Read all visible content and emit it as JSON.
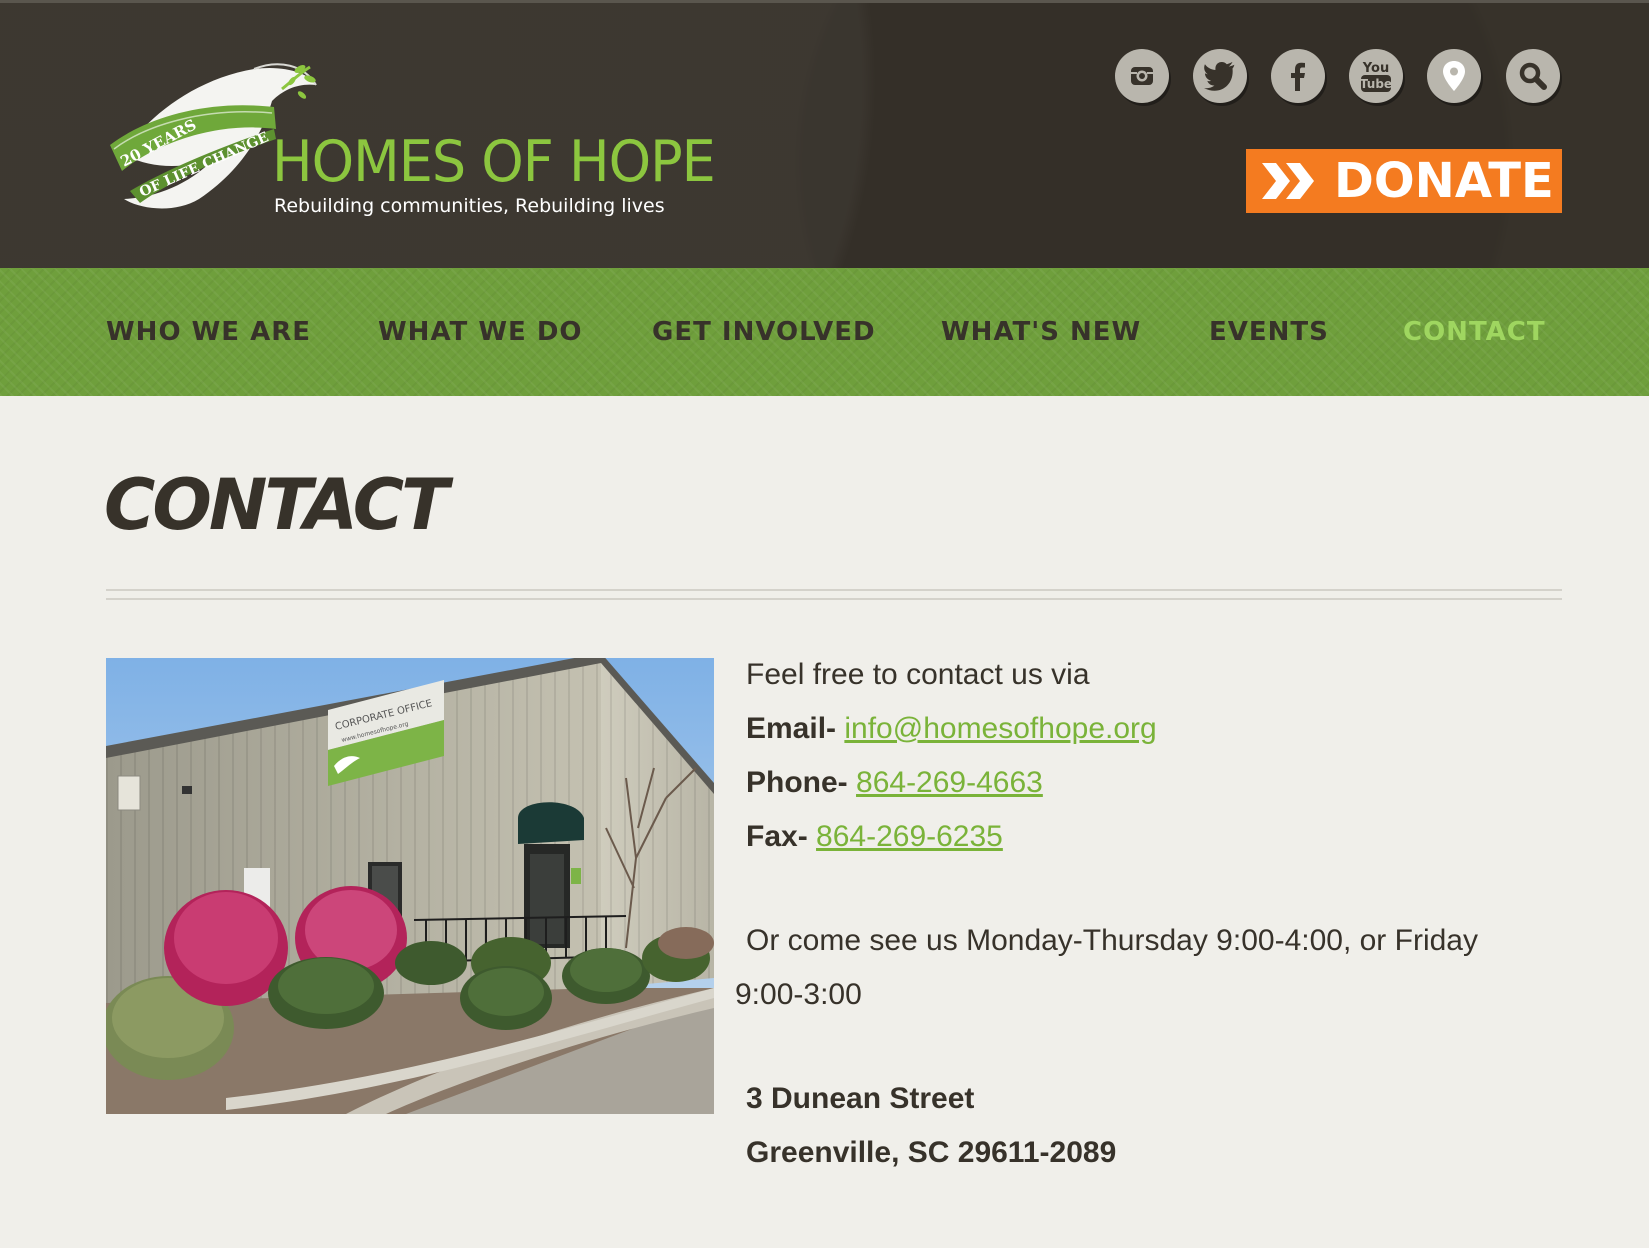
{
  "header": {
    "logo": {
      "ribbon_text": "20 YEARS OF LIFE CHANGE",
      "title": "HOMES OF HOPE",
      "tagline": "Rebuilding communities, Rebuilding lives"
    },
    "social_icons": [
      "instagram-icon",
      "twitter-icon",
      "facebook-icon",
      "youtube-icon",
      "map-pin-icon",
      "search-icon"
    ],
    "youtube_text_top": "You",
    "youtube_text_bottom": "Tube",
    "donate_label": "DONATE"
  },
  "nav": {
    "items": [
      {
        "label": "WHO WE ARE"
      },
      {
        "label": "WHAT WE DO"
      },
      {
        "label": "GET INVOLVED"
      },
      {
        "label": "WHAT'S NEW"
      },
      {
        "label": "EVENTS"
      },
      {
        "label": "CONTACT",
        "active": true
      }
    ]
  },
  "main": {
    "title": "CONTACT",
    "photo": {
      "sign_line1": "CORPORATE OFFICE",
      "sign_line2": "www.homesofhope.org"
    },
    "intro": "Feel free to contact us via",
    "email_label": "Email-",
    "email_value": "info@homesofhope.org",
    "phone_label": "Phone-",
    "phone_value": "864-269-4663",
    "fax_label": "Fax-",
    "fax_value": "864-269-6235",
    "hours_line1": "Or come see us Monday-Thursday 9:00-4:00, or Friday",
    "hours_line2": "9:00-3:00",
    "address_line1": "3 Dunean Street",
    "address_line2": "Greenville, SC 29611-2089"
  },
  "colors": {
    "header_bg": "#37322a",
    "nav_bg": "#6f9f3c",
    "active_nav": "#9fd660",
    "donate": "#f47b20",
    "link": "#7ab339",
    "page_bg": "#f0efea"
  }
}
